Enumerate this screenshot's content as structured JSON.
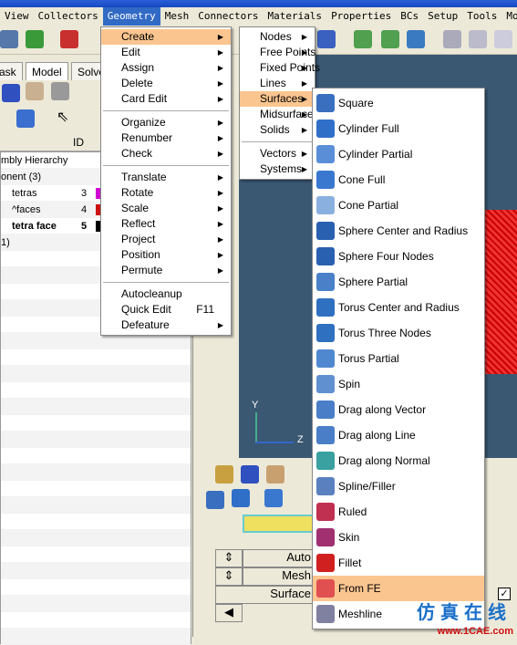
{
  "menubar": [
    "View",
    "Collectors",
    "Geometry",
    "Mesh",
    "Connectors",
    "Materials",
    "Properties",
    "BCs",
    "Setup",
    "Tools",
    "Morphi"
  ],
  "active_menu": "Geometry",
  "left_panel": {
    "tabs": [
      "ask",
      "Model",
      "Solve"
    ],
    "column_id": "ID",
    "rows": [
      {
        "name": "mbly Hierarchy",
        "id": "",
        "color": ""
      },
      {
        "name": "onent (3)",
        "id": "",
        "color": ""
      },
      {
        "name": "tetras",
        "id": "3",
        "color": "#d000d0"
      },
      {
        "name": "^faces",
        "id": "4",
        "color": "#cc1010"
      },
      {
        "name": "tetra  face",
        "id": "5",
        "color": "#000000",
        "bold": true
      },
      {
        "name": "1)",
        "id": "",
        "color": ""
      }
    ]
  },
  "geometry_menu": {
    "groups": [
      [
        {
          "label": "Create",
          "sub": true,
          "hl": true
        },
        {
          "label": "Edit",
          "sub": true
        },
        {
          "label": "Assign",
          "sub": true
        },
        {
          "label": "Delete",
          "sub": true
        },
        {
          "label": "Card Edit",
          "sub": true
        }
      ],
      [
        {
          "label": "Organize",
          "sub": true
        },
        {
          "label": "Renumber",
          "sub": true
        },
        {
          "label": "Check",
          "sub": true
        }
      ],
      [
        {
          "label": "Translate",
          "sub": true
        },
        {
          "label": "Rotate",
          "sub": true
        },
        {
          "label": "Scale",
          "sub": true
        },
        {
          "label": "Reflect",
          "sub": true
        },
        {
          "label": "Project",
          "sub": true
        },
        {
          "label": "Position",
          "sub": true
        },
        {
          "label": "Permute",
          "sub": true
        }
      ],
      [
        {
          "label": "Autocleanup"
        },
        {
          "label": "Quick Edit",
          "shortcut": "F11"
        },
        {
          "label": "Defeature",
          "sub": true
        }
      ]
    ]
  },
  "create_menu": {
    "groups": [
      [
        {
          "label": "Nodes",
          "sub": true
        },
        {
          "label": "Free Points",
          "sub": true
        },
        {
          "label": "Fixed Points",
          "sub": true
        },
        {
          "label": "Lines",
          "sub": true
        },
        {
          "label": "Surfaces",
          "sub": true,
          "hl": true
        },
        {
          "label": "Midsurfaces",
          "sub": true
        },
        {
          "label": "Solids",
          "sub": true
        }
      ],
      [
        {
          "label": "Vectors",
          "sub": true
        },
        {
          "label": "Systems",
          "sub": true
        }
      ]
    ]
  },
  "surfaces_menu": [
    {
      "label": "Square",
      "icon": "square-surface-icon",
      "color": "#3a6fc0"
    },
    {
      "label": "Cylinder Full",
      "icon": "cylinder-icon",
      "color": "#2f6fc8"
    },
    {
      "label": "Cylinder Partial",
      "icon": "cylinder-partial-icon",
      "color": "#5a8fd8"
    },
    {
      "label": "Cone Full",
      "icon": "cone-icon",
      "color": "#3a78d0"
    },
    {
      "label": "Cone Partial",
      "icon": "cone-partial-icon",
      "color": "#8ab0e0"
    },
    {
      "label": "Sphere Center and Radius",
      "icon": "sphere-icon",
      "color": "#2a60b0"
    },
    {
      "label": "Sphere Four Nodes",
      "icon": "sphere-nodes-icon",
      "color": "#2a60b0"
    },
    {
      "label": "Sphere Partial",
      "icon": "sphere-partial-icon",
      "color": "#4a80c8"
    },
    {
      "label": "Torus Center and Radius",
      "icon": "torus-icon",
      "color": "#3070c0"
    },
    {
      "label": "Torus Three Nodes",
      "icon": "torus-nodes-icon",
      "color": "#3070c0"
    },
    {
      "label": "Torus Partial",
      "icon": "torus-partial-icon",
      "color": "#5088d0"
    },
    {
      "label": "Spin",
      "icon": "spin-icon",
      "color": "#6090d0"
    },
    {
      "label": "Drag along Vector",
      "icon": "drag-vector-icon",
      "color": "#4a7fc8"
    },
    {
      "label": "Drag along Line",
      "icon": "drag-line-icon",
      "color": "#4a7fc8"
    },
    {
      "label": "Drag along Normal",
      "icon": "drag-normal-icon",
      "color": "#3aa0a0"
    },
    {
      "label": "Spline/Filler",
      "icon": "spline-filler-icon",
      "color": "#5a80c0"
    },
    {
      "label": "Ruled",
      "icon": "ruled-icon",
      "color": "#c03050"
    },
    {
      "label": "Skin",
      "icon": "skin-icon",
      "color": "#a03070"
    },
    {
      "label": "Fillet",
      "icon": "fillet-icon",
      "color": "#d02020"
    },
    {
      "label": "From FE",
      "icon": "from-fe-icon",
      "color": "#e05050",
      "hl": true
    },
    {
      "label": "Meshline",
      "icon": "meshline-icon",
      "color": "#8080a0"
    }
  ],
  "bottom_panel": {
    "buttons": [
      "Auto",
      "Mesh",
      "Surface"
    ]
  },
  "watermark": {
    "cn": "仿真在线",
    "url": "www.1CAE.com"
  },
  "axis_labels": [
    "Y",
    "Z"
  ]
}
